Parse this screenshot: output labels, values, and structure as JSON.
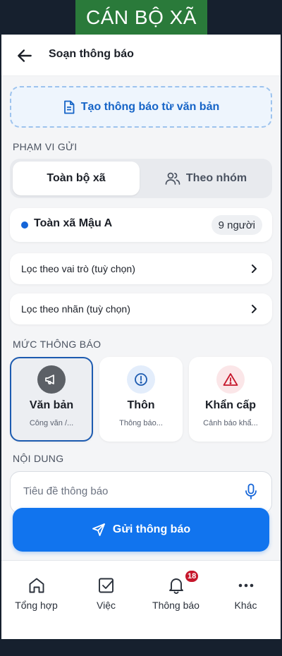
{
  "banner": {
    "text": "CÁN BỘ XÃ"
  },
  "header": {
    "title": "Soạn thông báo",
    "back_icon": "arrow-left-icon"
  },
  "create_from_text": {
    "label": "Tạo thông báo từ văn bản",
    "icon": "document-icon"
  },
  "scope": {
    "section_label": "PHẠM VI GỬI",
    "tabs": [
      {
        "label": "Toàn bộ xã",
        "selected": true
      },
      {
        "label": "Theo nhóm",
        "selected": false,
        "icon": "users-icon"
      }
    ],
    "selected_scope": {
      "name": "Toàn xã Mậu A",
      "count": "9 người"
    },
    "filters": [
      {
        "label": "Lọc theo vai trò (tuỳ chọn)"
      },
      {
        "label": "Lọc theo nhãn (tuỳ chọn)"
      }
    ]
  },
  "level": {
    "section_label": "MỨC THÔNG BÁO",
    "options": [
      {
        "name": "Văn bản",
        "sub": "Công văn /...",
        "icon": "megaphone-icon",
        "selected": true
      },
      {
        "name": "Thôn",
        "sub": "Thông báo...",
        "icon": "info-circle-icon",
        "selected": false
      },
      {
        "name": "Khẩn cấp",
        "sub": "Cảnh báo khẩ...",
        "icon": "warning-triangle-icon",
        "selected": false
      }
    ]
  },
  "content": {
    "section_label": "NỘI DUNG",
    "title_placeholder": "Tiêu đề thông báo",
    "mic_icon": "microphone-icon"
  },
  "send_button": {
    "label": "Gửi thông báo",
    "icon": "send-icon"
  },
  "bottom_nav": [
    {
      "label": "Tổng hợp",
      "icon": "home-icon"
    },
    {
      "label": "Việc",
      "icon": "checkbox-icon"
    },
    {
      "label": "Thông báo",
      "icon": "bell-icon",
      "badge": "18"
    },
    {
      "label": "Khác",
      "icon": "more-dots-icon"
    }
  ],
  "colors": {
    "accent": "#1174ee",
    "banner_green": "#2a7a3a",
    "badge_red": "#c6162b",
    "selected_border": "#1d5bb0"
  }
}
